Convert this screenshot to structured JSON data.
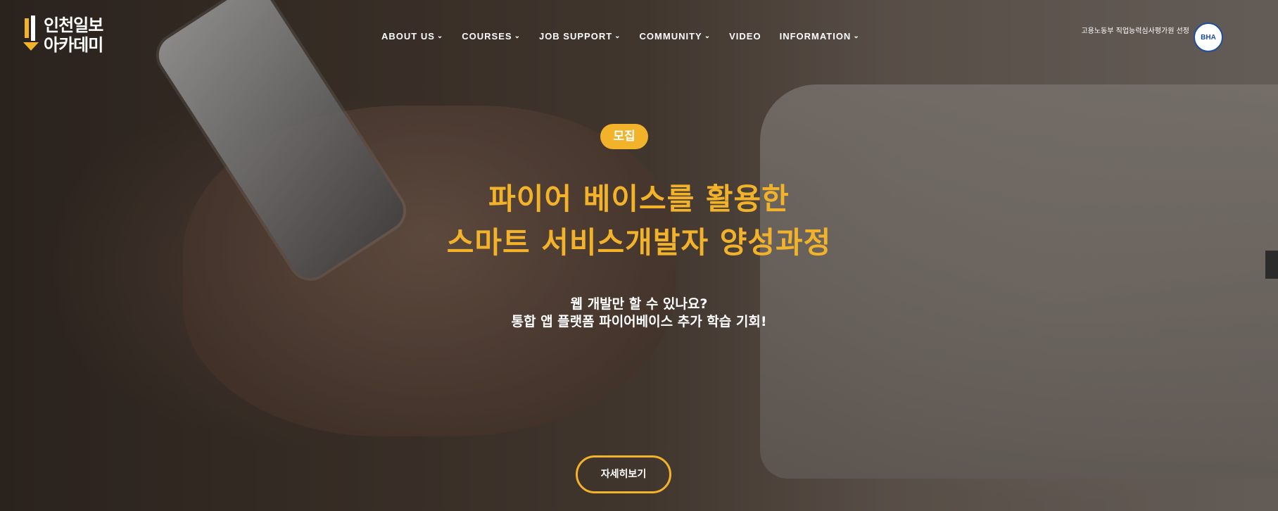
{
  "logo": {
    "line1": "인천일보",
    "line2": "아카데미"
  },
  "nav": {
    "items": [
      {
        "label": "ABOUT US",
        "dropdown": true
      },
      {
        "label": "COURSES",
        "dropdown": true
      },
      {
        "label": "JOB SUPPORT",
        "dropdown": true
      },
      {
        "label": "COMMUNITY",
        "dropdown": true
      },
      {
        "label": "VIDEO",
        "dropdown": false
      },
      {
        "label": "INFORMATION",
        "dropdown": true
      }
    ]
  },
  "certification": {
    "text": "고용노동부 직업능력심사평가원 선정",
    "seal": "BHA"
  },
  "hero": {
    "badge": "모집",
    "title_line1": "파이어 베이스를 활용한",
    "title_line2": "스마트 서비스개발자 양성과정",
    "subtitle_line1": "웹 개발만 할 수 있나요?",
    "subtitle_line2": "통합 앱 플랫폼 파이어베이스 추가 학습 기회!",
    "cta_label": "자세히보기"
  },
  "colors": {
    "accent": "#f2b229",
    "text": "#ffffff",
    "seal": "#1f4e9d"
  }
}
